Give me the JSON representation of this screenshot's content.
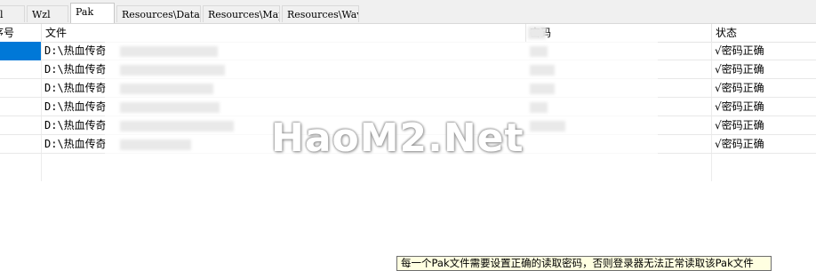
{
  "tabs": [
    {
      "label": "l",
      "active": false
    },
    {
      "label": "Wzl",
      "active": false
    },
    {
      "label": "Pak",
      "active": true
    },
    {
      "label": "Resources\\Data",
      "active": false
    },
    {
      "label": "Resources\\Map",
      "active": false
    },
    {
      "label": "Resources\\Wav",
      "active": false
    }
  ],
  "table": {
    "columns": [
      "序号",
      "文件",
      "密码",
      "状态"
    ],
    "rows": [
      {
        "path": "D:\\热血传奇",
        "status": "√密码正确"
      },
      {
        "path": "D:\\热血传奇",
        "status": "√密码正确"
      },
      {
        "path": "D:\\热血传奇",
        "status": "√密码正确"
      },
      {
        "path": "D:\\热血传奇",
        "status": "√密码正确"
      },
      {
        "path": "D:\\热血传奇",
        "status": "√密码正确"
      },
      {
        "path": "D:\\热血传奇",
        "status": "√密码正确"
      }
    ],
    "selected_row": 0
  },
  "watermark": "HaoM2.Net",
  "tooltip": "每一个Pak文件需要设置正确的读取密码，否则登录器无法正常读取该Pak文件",
  "colors": {
    "selection": "#0078d7",
    "tooltip_bg": "#ffffe1"
  }
}
